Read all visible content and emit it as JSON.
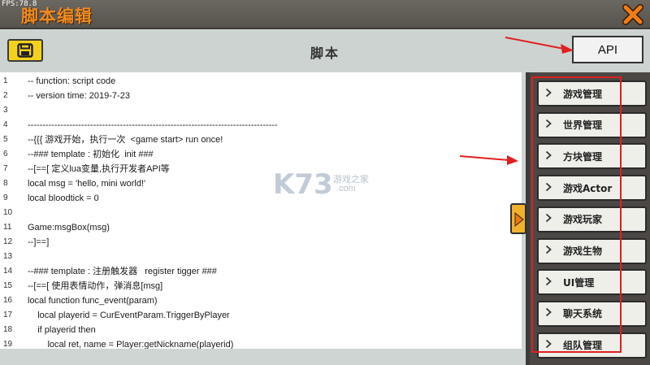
{
  "fps": "FPS:78.8",
  "window": {
    "title": "脚本编辑"
  },
  "toolbar": {
    "title": "脚本",
    "api_label": "API"
  },
  "editor": {
    "lines": [
      {
        "n": "1",
        "text": "-- function: script code"
      },
      {
        "n": "2",
        "text": "-- version time: 2019-7-23"
      },
      {
        "n": "3",
        "text": ""
      },
      {
        "n": "4",
        "text": "------------------------------------------------------------------------------------"
      },
      {
        "n": "5",
        "text": "--{{{ 游戏开始，执行一次  <game start> run once!"
      },
      {
        "n": "6",
        "text": "--### template : 初始化  init ###"
      },
      {
        "n": "7",
        "text": "--[==[ 定义lua变量,执行开发者API等"
      },
      {
        "n": "8",
        "text": "local msg = 'hello, mini world!'"
      },
      {
        "n": "9",
        "text": "local bloodtick = 0"
      },
      {
        "n": "10",
        "text": ""
      },
      {
        "n": "11",
        "text": "Game:msgBox(msg)"
      },
      {
        "n": "12",
        "text": "--]==]"
      },
      {
        "n": "13",
        "text": ""
      },
      {
        "n": "14",
        "text": "--### template : 注册触发器   register tigger ###"
      },
      {
        "n": "15",
        "text": "--[==[ 使用表情动作，弹消息[msg]"
      },
      {
        "n": "16",
        "text": "local function func_event(param)"
      },
      {
        "n": "17",
        "text": "    local playerid = CurEventParam.TriggerByPlayer"
      },
      {
        "n": "18",
        "text": "    if playerid then"
      },
      {
        "n": "19",
        "text": "        local ret, name = Player:getNickname(playerid)"
      }
    ]
  },
  "watermark": {
    "logo": "K73",
    "text": "游戏之家",
    "domain": ".com"
  },
  "api_panel": {
    "categories": [
      {
        "label": "游戏管理"
      },
      {
        "label": "世界管理"
      },
      {
        "label": "方块管理"
      },
      {
        "label": "游戏Actor"
      },
      {
        "label": "游戏玩家"
      },
      {
        "label": "游戏生物"
      },
      {
        "label": "UI管理"
      },
      {
        "label": "聊天系统"
      },
      {
        "label": "组队管理"
      }
    ]
  },
  "colors": {
    "title_orange": "#f08a1e",
    "save_yellow": "#f4d21c",
    "annotation_red": "#e02020"
  }
}
